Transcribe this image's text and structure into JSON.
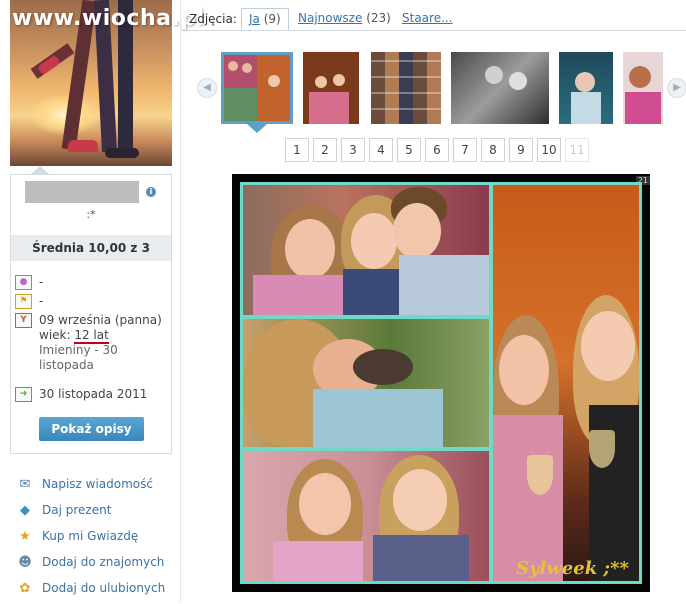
{
  "watermark": "www.wiocha.pl",
  "profile": {
    "status": ":*",
    "rating_text": "Średnia 10,00 z 3",
    "info": [
      {
        "icon": "person-icon",
        "value": "-"
      },
      {
        "icon": "flag-icon",
        "value": "-"
      },
      {
        "icon": "cocktail-icon",
        "value": "09 września (panna)"
      },
      {
        "icon": "",
        "value": "wiek: ",
        "highlight": "12 lat"
      },
      {
        "icon": "",
        "value": "Imieniny - 30 listopada"
      },
      {
        "icon": "arrow-right-icon",
        "value": "30 listopada 2011"
      }
    ],
    "show_desc_label": "Pokaż opisy"
  },
  "actions": [
    {
      "icon": "envelope-icon",
      "label": "Napisz wiadomość"
    },
    {
      "icon": "gift-icon",
      "label": "Daj prezent"
    },
    {
      "icon": "star-person-icon",
      "label": "Kup mi Gwiazdę"
    },
    {
      "icon": "add-friend-icon",
      "label": "Dodaj do znajomych"
    },
    {
      "icon": "flower-icon",
      "label": "Dodaj do ulubionych"
    }
  ],
  "tabs": {
    "label": "Zdjęcia:",
    "items": [
      {
        "label": "Ja",
        "count": "(9)",
        "active": true
      },
      {
        "label": "Najnowsze",
        "count": "(23)",
        "active": false
      },
      {
        "label": "Staare...",
        "count": "",
        "active": false
      }
    ]
  },
  "pager": [
    "1",
    "2",
    "3",
    "4",
    "5",
    "6",
    "7",
    "8",
    "9",
    "10",
    "11"
  ],
  "photo": {
    "counter": "21",
    "signature": "Sylweek ;**"
  }
}
